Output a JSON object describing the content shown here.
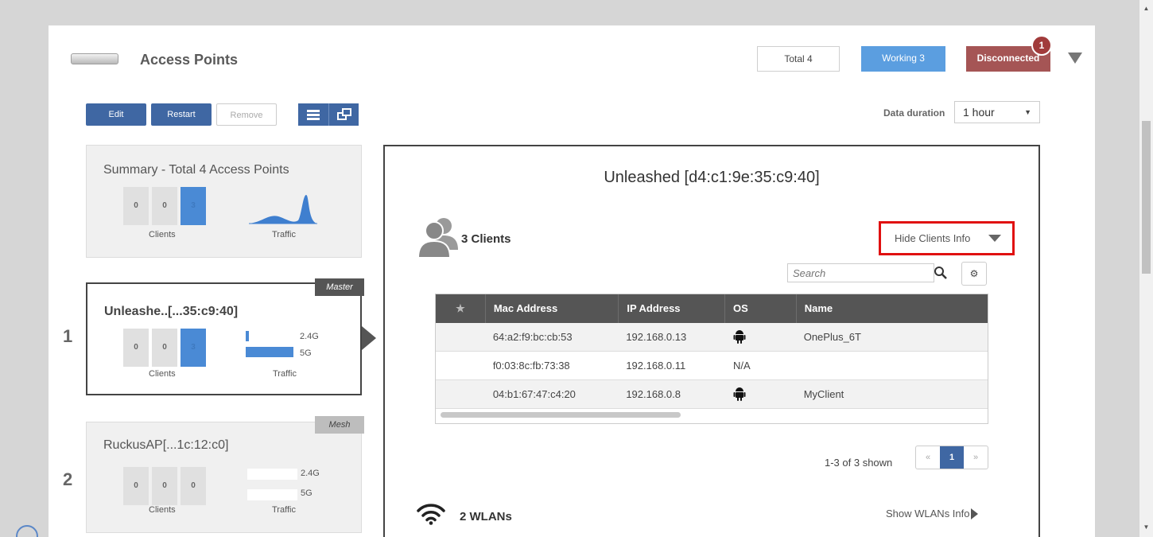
{
  "header": {
    "title": "Access Points",
    "stats": {
      "total": "Total 4",
      "working": "Working 3",
      "disconnected": "Disconnected",
      "badge": "1"
    }
  },
  "toolbar": {
    "edit": "Edit",
    "restart": "Restart",
    "remove": "Remove",
    "data_duration_label": "Data duration",
    "data_duration_value": "1 hour"
  },
  "summary": {
    "title": "Summary - Total 4 Access Points",
    "clients": [
      "0",
      "0",
      "3"
    ],
    "clients_label": "Clients",
    "traffic_label": "Traffic"
  },
  "aps": [
    {
      "index": "1",
      "name": "Unleashe..[...35:c9:40]",
      "tag": "Master",
      "clients": [
        "0",
        "0",
        "3"
      ],
      "band_24": "2.4G",
      "band_5": "5G",
      "clients_label": "Clients",
      "traffic_label": "Traffic"
    },
    {
      "index": "2",
      "name": "RuckusAP[...1c:12:c0]",
      "tag": "Mesh",
      "clients": [
        "0",
        "0",
        "0"
      ],
      "band_24": "2.4G",
      "band_5": "5G",
      "clients_label": "Clients",
      "traffic_label": "Traffic"
    }
  ],
  "detail": {
    "title": "Unleashed [d4:c1:9e:35:c9:40]",
    "clients_count": "3 Clients",
    "hide_clients": "Hide Clients Info",
    "search_placeholder": "Search",
    "columns": {
      "star": "★",
      "mac": "Mac Address",
      "ip": "IP Address",
      "os": "OS",
      "name": "Name"
    },
    "rows": [
      {
        "mac": "64:a2:f9:bc:cb:53",
        "ip": "192.168.0.13",
        "os": "android",
        "name": "OnePlus_6T"
      },
      {
        "mac": "f0:03:8c:fb:73:38",
        "ip": "192.168.0.11",
        "os": "N/A",
        "name": ""
      },
      {
        "mac": "04:b1:67:47:c4:20",
        "ip": "192.168.0.8",
        "os": "android",
        "name": "MyClient"
      }
    ],
    "shown": "1-3 of 3 shown",
    "pager": {
      "prev": "«",
      "current": "1",
      "next": "»"
    },
    "wlans_count": "2 WLANs",
    "show_wlans": "Show WLANs Info"
  },
  "colors": {
    "accent_blue": "#3f67a3",
    "working": "#5b9ee0",
    "disconnected": "#a55555",
    "highlight": "#e01010"
  }
}
